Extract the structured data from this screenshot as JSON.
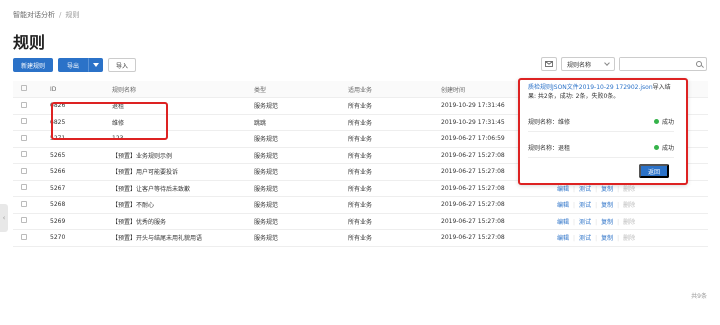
{
  "breadcrumb": {
    "parent": "智能对话分析",
    "separator": "/",
    "current": "规则"
  },
  "page_title": "规则",
  "toolbar": {
    "new_rule": "新建规则",
    "export": "导出",
    "import": "导入"
  },
  "filter": {
    "field": "规则名称",
    "search_value": ""
  },
  "table": {
    "headers": {
      "id": "ID",
      "name": "规则名称",
      "type": "类型",
      "biz": "适用业务",
      "time": "创建时间"
    },
    "rows": [
      {
        "id": "6826",
        "name": "退租",
        "type": "服务规范",
        "biz": "所有业务",
        "time": "2019-10-29 17:31:46"
      },
      {
        "id": "6825",
        "name": "维修",
        "type": "跳跳",
        "biz": "所有业务",
        "time": "2019-10-29 17:31:45"
      },
      {
        "id": "5271",
        "name": "123",
        "type": "服务规范",
        "biz": "所有业务",
        "time": "2019-06-27 17:06:59"
      },
      {
        "id": "5265",
        "name": "【预置】业务规则示例",
        "type": "服务规范",
        "biz": "所有业务",
        "time": "2019-06-27 15:27:08"
      },
      {
        "id": "5266",
        "name": "【预置】用户可能要投诉",
        "type": "服务规范",
        "biz": "所有业务",
        "time": "2019-06-27 15:27:08",
        "actions": true
      },
      {
        "id": "5267",
        "name": "【预置】让客户等待后未致歉",
        "type": "服务规范",
        "biz": "所有业务",
        "time": "2019-06-27 15:27:08",
        "actions": true
      },
      {
        "id": "5268",
        "name": "【预置】不耐心",
        "type": "服务规范",
        "biz": "所有业务",
        "time": "2019-06-27 15:27:08",
        "actions": true
      },
      {
        "id": "5269",
        "name": "【预置】优秀的服务",
        "type": "服务规范",
        "biz": "所有业务",
        "time": "2019-06-27 15:27:08",
        "actions": true
      },
      {
        "id": "5270",
        "name": "【预置】开头与结尾未用礼貌用语",
        "type": "服务规范",
        "biz": "所有业务",
        "time": "2019-06-27 15:27:08",
        "actions": true
      }
    ],
    "actions": {
      "edit": "编辑",
      "test": "测试",
      "copy": "复制",
      "delete": "删除"
    }
  },
  "footer": {
    "total": "共9条"
  },
  "popup": {
    "message_prefix": "质检规则JSON文件2019-10-29 172902.json",
    "message_suffix": "导入结果: 共2条，成功: 2条，失败0条。",
    "results": [
      {
        "label": "规则名称：维修",
        "status": "成功"
      },
      {
        "label": "规则名称：退租",
        "status": "成功"
      }
    ],
    "back_label": "返回"
  },
  "colors": {
    "accent": "#2b72c8",
    "highlight": "#dd2222",
    "success": "#35b34a"
  }
}
